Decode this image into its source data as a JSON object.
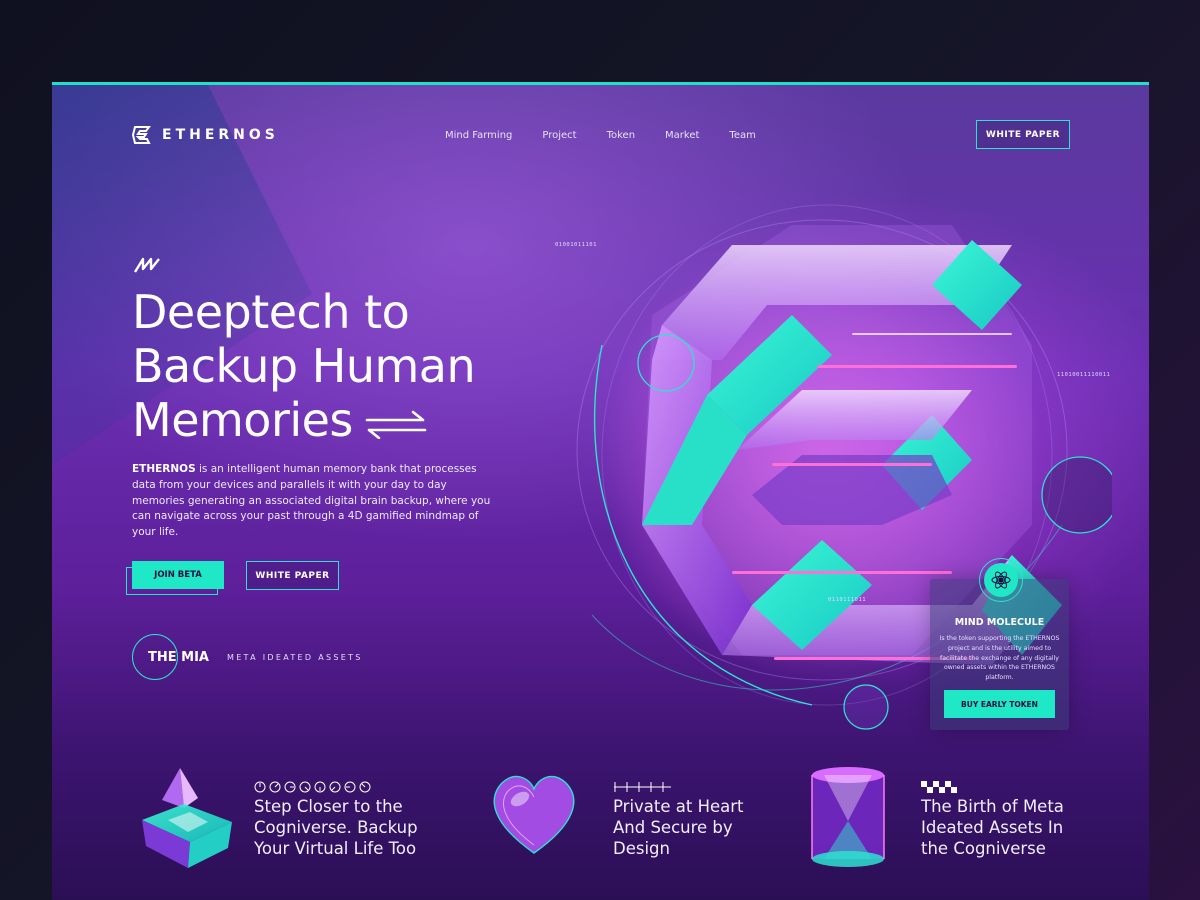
{
  "brand": {
    "name": "ETHERNOS",
    "accent": "#1ee8c6",
    "background": "#6a2fb2"
  },
  "nav": {
    "items": [
      "Mind Farming",
      "Project",
      "Token",
      "Market",
      "Team"
    ],
    "cta": "WHITE PAPER"
  },
  "hero": {
    "title_lines": [
      "Deeptech to",
      "Backup Human",
      "Memories"
    ],
    "desc_brand": "ETHERNOS",
    "desc": " is an intelligent human memory bank that processes data from your devices and parallels it with your day to day memories generating an associated digital brain backup, where you can navigate across your past through a 4D gamified mindmap of your life.",
    "join_label": "JOIN BETA",
    "whitepaper_label": "WHITE PAPER"
  },
  "mia": {
    "title": "THE MIA",
    "subtitle": "META IDEATED ASSETS"
  },
  "graphic": {
    "binary_1": "01001011101",
    "binary_2": "11010011110011",
    "binary_3": "0110111011"
  },
  "token": {
    "title": "MIND MOLECULE",
    "desc": "Is the token supporting the ETHERNOS project and is the utility aimed to facilitate the exchange of any digitally owned assets within the ETHERNOS platform.",
    "cta": "BUY EARLY TOKEN"
  },
  "features": [
    {
      "title_lines": [
        "Step Closer to the",
        "Cogniverse. Backup",
        "Your Virtual Life Too"
      ],
      "icon": "pyramid-icon"
    },
    {
      "title_lines": [
        "Private at Heart",
        "And  Secure by",
        "Design"
      ],
      "icon": "heart-icon"
    },
    {
      "title_lines": [
        "The Birth of Meta",
        "Ideated Assets In",
        "the Cogniverse"
      ],
      "icon": "cylinder-icon"
    }
  ]
}
